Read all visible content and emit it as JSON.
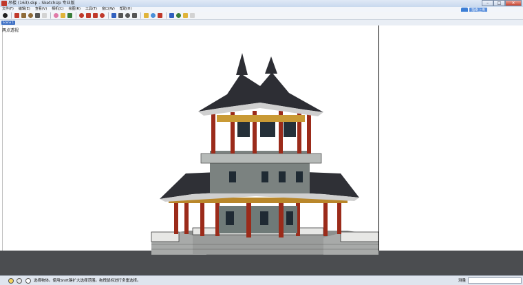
{
  "window": {
    "title": "吊楼 (163).skp - SketchUp 专业版",
    "controls": {
      "minimize": "–",
      "maximize": "□",
      "close": "✕"
    }
  },
  "menu": {
    "items": [
      "文件(F)",
      "编辑(E)",
      "查看(V)",
      "相机(C)",
      "绘图(R)",
      "工具(T)",
      "窗口(W)",
      "帮助(H)"
    ]
  },
  "cloud_upload": {
    "label": "指南上传",
    "icon": "cloud-upload-icon"
  },
  "toolbar": {
    "tools": [
      {
        "name": "select-tool",
        "icon": "arrow-icon",
        "color": "#222222"
      },
      {
        "name": "line-tool",
        "icon": "pencil-icon",
        "color": "#c0392b"
      },
      {
        "name": "rectangle-tool",
        "icon": "rectangle-icon",
        "color": "#8e6b3a"
      },
      {
        "name": "circle-tool",
        "icon": "circle-icon",
        "color": "#8e6b3a"
      },
      {
        "name": "arc-tool",
        "icon": "arc-icon",
        "color": "#555555"
      },
      {
        "name": "make-component-tool",
        "icon": "component-icon",
        "color": "#d3d3d3"
      },
      {
        "name": "eraser-tool",
        "icon": "eraser-icon",
        "color": "#e07aa8"
      },
      {
        "name": "tape-measure-tool",
        "icon": "tape-icon",
        "color": "#e0b43a"
      },
      {
        "name": "paint-bucket-tool",
        "icon": "bucket-icon",
        "color": "#3a7d3a"
      },
      {
        "name": "push-pull-tool",
        "icon": "pushpull-icon",
        "color": "#c0392b"
      },
      {
        "name": "move-tool",
        "icon": "move-icon",
        "color": "#c0392b"
      },
      {
        "name": "rotate-tool",
        "icon": "rotate-icon",
        "color": "#c0392b"
      },
      {
        "name": "offset-tool",
        "icon": "offset-icon",
        "color": "#c0392b"
      },
      {
        "name": "orbit-tool",
        "icon": "orbit-icon",
        "color": "#2f5fbf"
      },
      {
        "name": "pan-tool",
        "icon": "hand-icon",
        "color": "#555555"
      },
      {
        "name": "zoom-tool",
        "icon": "magnifier-icon",
        "color": "#555555"
      },
      {
        "name": "zoom-extents-tool",
        "icon": "zoom-extents-icon",
        "color": "#555555"
      },
      {
        "name": "warehouse-tool",
        "icon": "warehouse-icon",
        "color": "#e0b43a"
      },
      {
        "name": "share-model-tool",
        "icon": "share-icon",
        "color": "#4a90d9"
      },
      {
        "name": "extension-tool",
        "icon": "extension-icon",
        "color": "#c0392b"
      },
      {
        "name": "model-info-tool",
        "icon": "model-info-icon",
        "color": "#2f5fbf"
      },
      {
        "name": "layout-tool",
        "icon": "layout-icon",
        "color": "#3a7d3a"
      },
      {
        "name": "styles-tool",
        "icon": "styles-icon",
        "color": "#e0b43a"
      },
      {
        "name": "sandbox-tool",
        "icon": "sandbox-icon",
        "color": "#d3d3d3"
      }
    ]
  },
  "scene": {
    "tab_label": "Scene 1"
  },
  "viewport": {
    "view_label": "两点透视"
  },
  "status": {
    "message": "选择物体。使用Shift键扩大选择范围。拖拽鼠标进行多重选择。",
    "measure_label": "测量",
    "measure_value": ""
  }
}
